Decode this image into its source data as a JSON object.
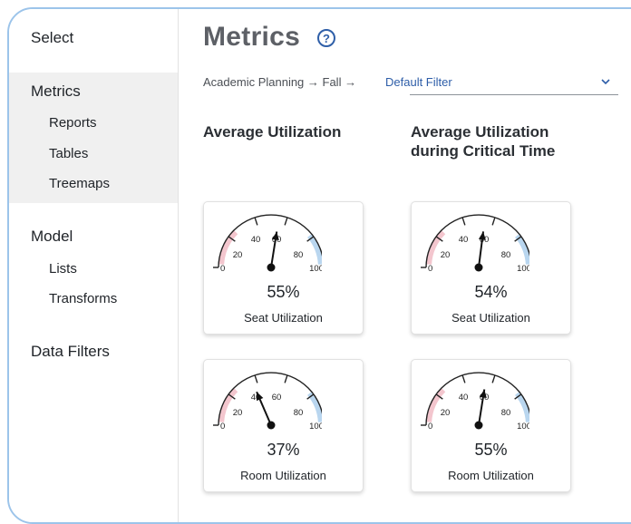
{
  "sidebar": {
    "select_label": "Select",
    "sections": [
      {
        "label": "Metrics",
        "items": [
          "Reports",
          "Tables",
          "Treemaps"
        ]
      },
      {
        "label": "Model",
        "items": [
          "Lists",
          "Transforms"
        ]
      },
      {
        "label": "Data Filters",
        "items": []
      }
    ]
  },
  "header": {
    "title": "Metrics",
    "help_icon": "?",
    "breadcrumb": "Academic Planning → Fall →",
    "filter": {
      "value": "Default Filter"
    }
  },
  "columns": [
    {
      "title_line1": "Average Utilization",
      "title_line2": ""
    },
    {
      "title_line1": "Average Utilization",
      "title_line2": "during Critical Time"
    }
  ],
  "gauge_tick_labels": [
    "0",
    "20",
    "40",
    "60",
    "80",
    "100"
  ],
  "cards": [
    {
      "percent": 55,
      "percent_label": "55%",
      "label": "Seat Utilization"
    },
    {
      "percent": 54,
      "percent_label": "54%",
      "label": "Seat Utilization"
    },
    {
      "percent": 37,
      "percent_label": "37%",
      "label": "Room Utilization"
    },
    {
      "percent": 55,
      "percent_label": "55%",
      "label": "Room Utilization"
    }
  ],
  "colors": {
    "frame": "#9cc4ea",
    "gauge_low": "#f3c6ce",
    "gauge_high": "#b9d6ef",
    "link": "#2d5da8"
  }
}
